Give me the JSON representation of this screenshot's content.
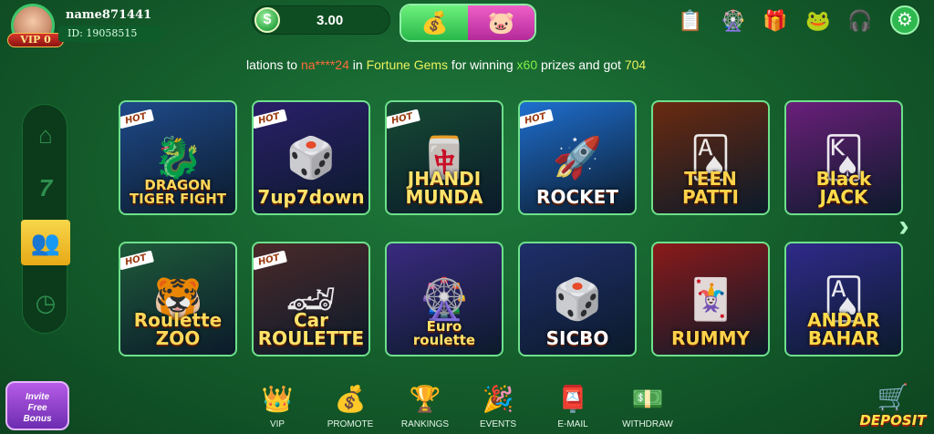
{
  "profile": {
    "username": "name871441",
    "id_text": "ID: 19058515",
    "vip_text": "VIP 0"
  },
  "wallet": {
    "currency_icon": "$",
    "balance": "3.00"
  },
  "promo_buttons": [
    {
      "name": "treasure-chest",
      "icon": "💰"
    },
    {
      "name": "piggy-bank",
      "icon": "🐷"
    }
  ],
  "top_icons": [
    {
      "name": "tasks-icon",
      "glyph": "📋"
    },
    {
      "name": "lucky-wheel-icon",
      "glyph": "🎡"
    },
    {
      "name": "gift-icon",
      "glyph": "🎁"
    },
    {
      "name": "mascot-icon",
      "glyph": "🐸"
    },
    {
      "name": "support-icon",
      "glyph": "🎧"
    }
  ],
  "settings_icon": "⚙",
  "marquee": {
    "part1": "lations to ",
    "player": "na****24",
    "part2": " in ",
    "game": "Fortune Gems",
    "part3": " for winning ",
    "mult": "x60",
    "part4": " prizes and got ",
    "amount": "704"
  },
  "sidenav": [
    {
      "name": "home-icon",
      "glyph": "⌂",
      "active": false
    },
    {
      "name": "slots-icon",
      "glyph": "7",
      "active": false
    },
    {
      "name": "multiplayer-icon",
      "glyph": "👥",
      "active": true
    },
    {
      "name": "history-icon",
      "glyph": "◷",
      "active": false
    }
  ],
  "games_row1": [
    {
      "title": "DRAGON\nTIGER FIGHT",
      "hot": true,
      "art": "🐉",
      "bg": "#1f4a8a"
    },
    {
      "title": "7up7down",
      "hot": true,
      "art": "🎲",
      "bg": "#2a1f6a"
    },
    {
      "title": "JHANDI\nMUNDA",
      "hot": true,
      "art": "🀄",
      "bg": "#164a33"
    },
    {
      "title": "ROCKET",
      "hot": true,
      "art": "🚀",
      "bg": "#1f6fd0"
    },
    {
      "title": "TEEN\nPATTI",
      "hot": false,
      "art": "🂡",
      "bg": "#6a2a10"
    },
    {
      "title": "Black\nJACK",
      "hot": false,
      "art": "🂮",
      "bg": "#6a1f7a"
    }
  ],
  "games_row2": [
    {
      "title": "Roulette\nZOO",
      "hot": true,
      "art": "🐯",
      "bg": "#1e5a3a"
    },
    {
      "title": "Car\nROULETTE",
      "hot": true,
      "art": "🏎",
      "bg": "#4a2a2a"
    },
    {
      "title": "Euro\nroulette",
      "hot": false,
      "art": "🎡",
      "bg": "#3a2a80"
    },
    {
      "title": "SICBO",
      "hot": false,
      "art": "🎲",
      "bg": "#1f2f6a"
    },
    {
      "title": "RUMMY",
      "hot": false,
      "art": "🃏",
      "bg": "#8a1a1a"
    },
    {
      "title": "ANDAR\nBAHAR",
      "hot": false,
      "art": "🂡",
      "bg": "#2f2a8a"
    }
  ],
  "hot_label": "HOT",
  "next_arrow": "›",
  "bottom_nav": [
    {
      "label": "VIP",
      "glyph": "👑"
    },
    {
      "label": "PROMOTE",
      "glyph": "💰"
    },
    {
      "label": "RANKINGS",
      "glyph": "🏆"
    },
    {
      "label": "EVENTS",
      "glyph": "🎉"
    },
    {
      "label": "E-MAIL",
      "glyph": "📮"
    },
    {
      "label": "WITHDRAW",
      "glyph": "💵"
    }
  ],
  "invite": {
    "line1": "Invite",
    "line2": "Free",
    "line3": "Bonus"
  },
  "deposit": {
    "glyph": "🛒",
    "label": "DEPOSIT"
  }
}
